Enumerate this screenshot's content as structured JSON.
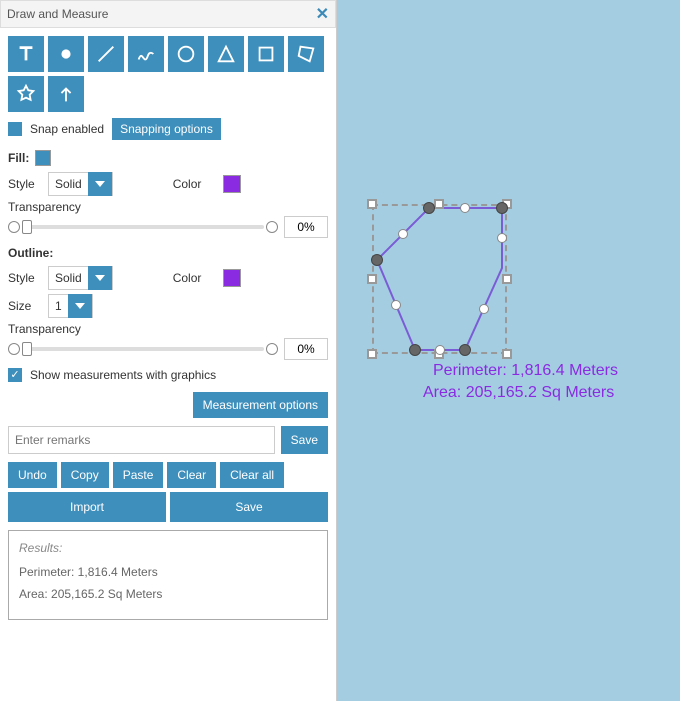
{
  "panel": {
    "title": "Draw and Measure",
    "snap_label": "Snap enabled",
    "snap_options_btn": "Snapping options",
    "fill": {
      "heading": "Fill:",
      "style_label": "Style",
      "style_value": "Solid",
      "color_label": "Color",
      "color_value": "#8a2be2",
      "transparency_label": "Transparency",
      "transparency_value": "0%"
    },
    "outline": {
      "heading": "Outline:",
      "style_label": "Style",
      "style_value": "Solid",
      "color_label": "Color",
      "color_value": "#8a2be2",
      "size_label": "Size",
      "size_value": "1",
      "transparency_label": "Transparency",
      "transparency_value": "0%"
    },
    "show_measurements_label": "Show measurements with graphics",
    "measurement_options_btn": "Measurement options",
    "remarks_placeholder": "Enter remarks",
    "save_btn": "Save",
    "undo_btn": "Undo",
    "copy_btn": "Copy",
    "paste_btn": "Paste",
    "clear_btn": "Clear",
    "clear_all_btn": "Clear all",
    "import_btn": "Import",
    "save2_btn": "Save",
    "results": {
      "heading": "Results:",
      "perimeter": "Perimeter: 1,816.4 Meters",
      "area": "Area: 205,165.2 Sq Meters"
    }
  },
  "canvas": {
    "perimeter_text": "Perimeter: 1,816.4 Meters",
    "area_text": "Area: 205,165.2 Sq Meters"
  }
}
